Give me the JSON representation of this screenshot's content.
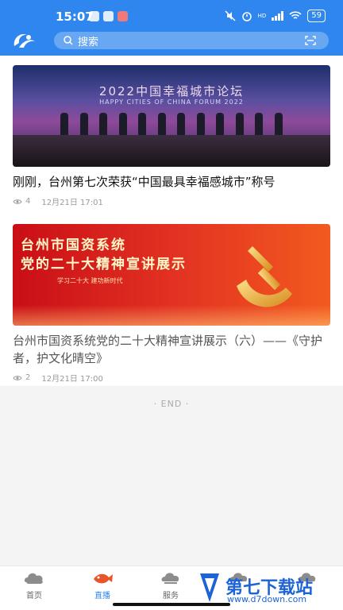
{
  "status_bar": {
    "time": "15:07",
    "battery": "59",
    "network": "HD"
  },
  "search": {
    "placeholder": "搜索"
  },
  "news": [
    {
      "banner_title": "2022中国幸福城市论坛",
      "banner_subtitle": "HAPPY CITIES OF CHINA FORUM 2022",
      "title": "刚刚，台州第七次荣获“中国最具幸福感城市”称号",
      "views": "4",
      "date": "12月21日 17:01"
    },
    {
      "banner_title_line1": "台州市国资系统",
      "banner_title_line2": "党的二十大精神宣讲展示",
      "banner_slogan": "学习二十大  建功新时代",
      "title": "台州市国资系统党的二十大精神宣讲展示（六）——《守护者，护文化晴空》",
      "views": "2",
      "date": "12月21日 17:00"
    }
  ],
  "end_text": "· END ·",
  "tabs": [
    {
      "label": "首页",
      "icon": "home-cloud-icon",
      "active": false
    },
    {
      "label": "直播",
      "icon": "live-fish-icon",
      "active": true
    },
    {
      "label": "服务",
      "icon": "service-cloud-icon",
      "active": false
    },
    {
      "label": "",
      "icon": "cloud-icon",
      "active": false
    },
    {
      "label": "",
      "icon": "cloud-icon",
      "active": false
    }
  ],
  "watermark": {
    "text": "第七下载站",
    "url": "www.d7down.com"
  },
  "colors": {
    "brand_blue": "#2f86ee",
    "active_tab": "#2f86ee"
  }
}
